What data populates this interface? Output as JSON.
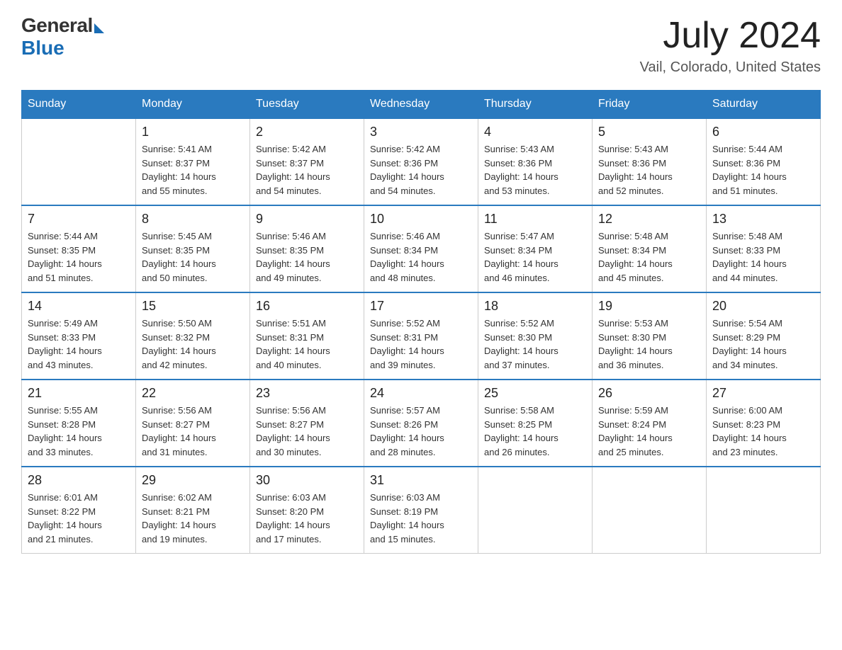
{
  "header": {
    "logo_general": "General",
    "logo_blue": "Blue",
    "month_year": "July 2024",
    "location": "Vail, Colorado, United States"
  },
  "days_of_week": [
    "Sunday",
    "Monday",
    "Tuesday",
    "Wednesday",
    "Thursday",
    "Friday",
    "Saturday"
  ],
  "weeks": [
    [
      {
        "day": "",
        "info": ""
      },
      {
        "day": "1",
        "info": "Sunrise: 5:41 AM\nSunset: 8:37 PM\nDaylight: 14 hours\nand 55 minutes."
      },
      {
        "day": "2",
        "info": "Sunrise: 5:42 AM\nSunset: 8:37 PM\nDaylight: 14 hours\nand 54 minutes."
      },
      {
        "day": "3",
        "info": "Sunrise: 5:42 AM\nSunset: 8:36 PM\nDaylight: 14 hours\nand 54 minutes."
      },
      {
        "day": "4",
        "info": "Sunrise: 5:43 AM\nSunset: 8:36 PM\nDaylight: 14 hours\nand 53 minutes."
      },
      {
        "day": "5",
        "info": "Sunrise: 5:43 AM\nSunset: 8:36 PM\nDaylight: 14 hours\nand 52 minutes."
      },
      {
        "day": "6",
        "info": "Sunrise: 5:44 AM\nSunset: 8:36 PM\nDaylight: 14 hours\nand 51 minutes."
      }
    ],
    [
      {
        "day": "7",
        "info": "Sunrise: 5:44 AM\nSunset: 8:35 PM\nDaylight: 14 hours\nand 51 minutes."
      },
      {
        "day": "8",
        "info": "Sunrise: 5:45 AM\nSunset: 8:35 PM\nDaylight: 14 hours\nand 50 minutes."
      },
      {
        "day": "9",
        "info": "Sunrise: 5:46 AM\nSunset: 8:35 PM\nDaylight: 14 hours\nand 49 minutes."
      },
      {
        "day": "10",
        "info": "Sunrise: 5:46 AM\nSunset: 8:34 PM\nDaylight: 14 hours\nand 48 minutes."
      },
      {
        "day": "11",
        "info": "Sunrise: 5:47 AM\nSunset: 8:34 PM\nDaylight: 14 hours\nand 46 minutes."
      },
      {
        "day": "12",
        "info": "Sunrise: 5:48 AM\nSunset: 8:34 PM\nDaylight: 14 hours\nand 45 minutes."
      },
      {
        "day": "13",
        "info": "Sunrise: 5:48 AM\nSunset: 8:33 PM\nDaylight: 14 hours\nand 44 minutes."
      }
    ],
    [
      {
        "day": "14",
        "info": "Sunrise: 5:49 AM\nSunset: 8:33 PM\nDaylight: 14 hours\nand 43 minutes."
      },
      {
        "day": "15",
        "info": "Sunrise: 5:50 AM\nSunset: 8:32 PM\nDaylight: 14 hours\nand 42 minutes."
      },
      {
        "day": "16",
        "info": "Sunrise: 5:51 AM\nSunset: 8:31 PM\nDaylight: 14 hours\nand 40 minutes."
      },
      {
        "day": "17",
        "info": "Sunrise: 5:52 AM\nSunset: 8:31 PM\nDaylight: 14 hours\nand 39 minutes."
      },
      {
        "day": "18",
        "info": "Sunrise: 5:52 AM\nSunset: 8:30 PM\nDaylight: 14 hours\nand 37 minutes."
      },
      {
        "day": "19",
        "info": "Sunrise: 5:53 AM\nSunset: 8:30 PM\nDaylight: 14 hours\nand 36 minutes."
      },
      {
        "day": "20",
        "info": "Sunrise: 5:54 AM\nSunset: 8:29 PM\nDaylight: 14 hours\nand 34 minutes."
      }
    ],
    [
      {
        "day": "21",
        "info": "Sunrise: 5:55 AM\nSunset: 8:28 PM\nDaylight: 14 hours\nand 33 minutes."
      },
      {
        "day": "22",
        "info": "Sunrise: 5:56 AM\nSunset: 8:27 PM\nDaylight: 14 hours\nand 31 minutes."
      },
      {
        "day": "23",
        "info": "Sunrise: 5:56 AM\nSunset: 8:27 PM\nDaylight: 14 hours\nand 30 minutes."
      },
      {
        "day": "24",
        "info": "Sunrise: 5:57 AM\nSunset: 8:26 PM\nDaylight: 14 hours\nand 28 minutes."
      },
      {
        "day": "25",
        "info": "Sunrise: 5:58 AM\nSunset: 8:25 PM\nDaylight: 14 hours\nand 26 minutes."
      },
      {
        "day": "26",
        "info": "Sunrise: 5:59 AM\nSunset: 8:24 PM\nDaylight: 14 hours\nand 25 minutes."
      },
      {
        "day": "27",
        "info": "Sunrise: 6:00 AM\nSunset: 8:23 PM\nDaylight: 14 hours\nand 23 minutes."
      }
    ],
    [
      {
        "day": "28",
        "info": "Sunrise: 6:01 AM\nSunset: 8:22 PM\nDaylight: 14 hours\nand 21 minutes."
      },
      {
        "day": "29",
        "info": "Sunrise: 6:02 AM\nSunset: 8:21 PM\nDaylight: 14 hours\nand 19 minutes."
      },
      {
        "day": "30",
        "info": "Sunrise: 6:03 AM\nSunset: 8:20 PM\nDaylight: 14 hours\nand 17 minutes."
      },
      {
        "day": "31",
        "info": "Sunrise: 6:03 AM\nSunset: 8:19 PM\nDaylight: 14 hours\nand 15 minutes."
      },
      {
        "day": "",
        "info": ""
      },
      {
        "day": "",
        "info": ""
      },
      {
        "day": "",
        "info": ""
      }
    ]
  ]
}
